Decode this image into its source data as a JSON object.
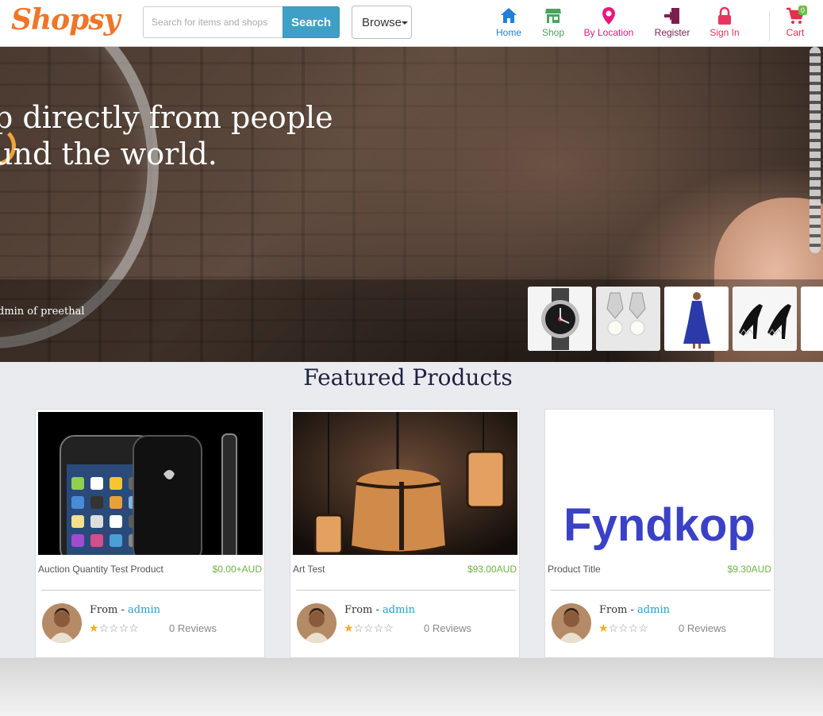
{
  "header": {
    "logo": "Shopsy",
    "search": {
      "placeholder": "Search for items and shops",
      "button": "Search"
    },
    "browse": "Browse",
    "nav": [
      {
        "label": "Home",
        "icon": "home-icon",
        "color": "#1f7fd9"
      },
      {
        "label": "Shop",
        "icon": "shop-icon",
        "color": "#4aa35b"
      },
      {
        "label": "By Location",
        "icon": "location-pin-icon",
        "color": "#e6197b"
      },
      {
        "label": "Register",
        "icon": "register-icon",
        "color": "#7b1f4f"
      },
      {
        "label": "Sign In",
        "icon": "lock-icon",
        "color": "#e8345f"
      }
    ],
    "cart": {
      "label": "Cart",
      "count": "0",
      "icon": "cart-icon"
    }
  },
  "hero": {
    "line1": "p directly from people",
    "line2": "und the world.",
    "caption": "dmin of preethal",
    "thumbnails": [
      "watch",
      "pearl-earrings",
      "blue-dress",
      "spiked-heels",
      "more"
    ]
  },
  "featured": {
    "title": "Featured Products",
    "products": [
      {
        "title": "Auction Quantity Test Product",
        "price": "$0.00+AUD",
        "from_label": "From - ",
        "seller": "admin",
        "rating": 1,
        "reviews": "0 Reviews"
      },
      {
        "title": "Art Test",
        "price": "$93.00AUD",
        "from_label": "From - ",
        "seller": "admin",
        "rating": 1,
        "reviews": "0 Reviews"
      },
      {
        "title": "Product Title",
        "price": "$9.30AUD",
        "from_label": "From - ",
        "seller": "admin",
        "rating": 1,
        "reviews": "0 Reviews",
        "image_text": "Fyndkop"
      }
    ]
  },
  "colors": {
    "accent": "#3fa0c6",
    "price": "#6cb33f",
    "logo": "#ef7528",
    "star": "#f2b01e"
  }
}
